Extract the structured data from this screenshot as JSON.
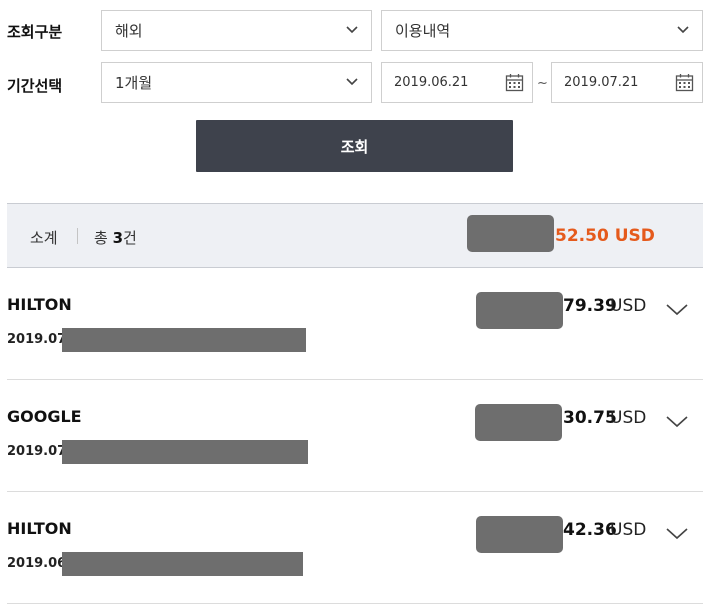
{
  "filters": {
    "category_label": "조회구분",
    "region_value": "해외",
    "type_value": "이용내역",
    "period_label": "기간선택",
    "period_value": "1개월",
    "start_date": "2019.06.21",
    "date_separator": "~",
    "end_date": "2019.07.21",
    "search_label": "조회"
  },
  "summary": {
    "label": "소계",
    "count_prefix": "총",
    "count": "3",
    "count_suffix": "건",
    "total_amount": "52.50 USD"
  },
  "transactions": [
    {
      "merchant": "HILTON",
      "date_prefix": "2019.07.",
      "amount": "79.39",
      "currency": "USD"
    },
    {
      "merchant": "GOOGLE",
      "date_prefix": "2019.07.",
      "amount": "30.75",
      "currency": "USD"
    },
    {
      "merchant": "HILTON",
      "date_prefix": "2019.06.",
      "amount": "42.36",
      "currency": "USD"
    }
  ],
  "colors": {
    "accent": "#e55a1c",
    "button_bg": "#3e424c",
    "summary_bg": "#eef0f4",
    "mask": "#6e6e6e"
  },
  "icons": {
    "dropdown": "chevron-down-icon",
    "calendar": "calendar-icon",
    "expand": "chevron-down-icon"
  }
}
